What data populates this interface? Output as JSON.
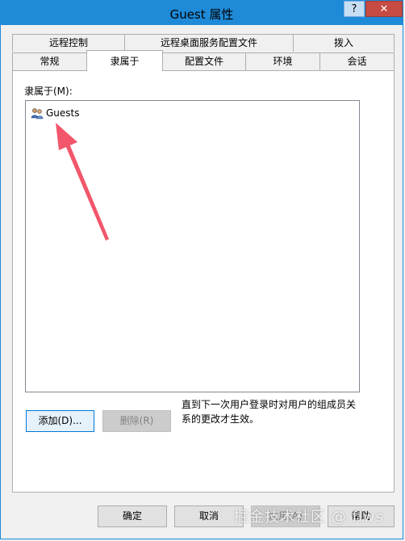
{
  "window": {
    "title": "Guest 属性",
    "help_label": "?",
    "close_label": "✕"
  },
  "tabs": {
    "row1": [
      "远程控制",
      "远程桌面服务配置文件",
      "拨入"
    ],
    "row2": [
      "常规",
      "隶属于",
      "配置文件",
      "环境",
      "会话"
    ],
    "active": "隶属于"
  },
  "panel": {
    "member_label": "隶属于(M):",
    "members": [
      {
        "name": "Guests",
        "icon": "group-icon"
      }
    ],
    "add_button": "添加(D)...",
    "remove_button": "删除(R)",
    "note": "直到下一次用户登录时对用户的组成员关系的更改才生效。"
  },
  "footer": {
    "ok": "确定",
    "cancel": "取消",
    "apply": "应用(A)",
    "help": "帮助"
  },
  "watermark": "掘金技术社区 @ flws",
  "colors": {
    "titlebar": "#1e8ad8",
    "close": "#c74b43",
    "annotation_arrow": "#f2566a"
  }
}
